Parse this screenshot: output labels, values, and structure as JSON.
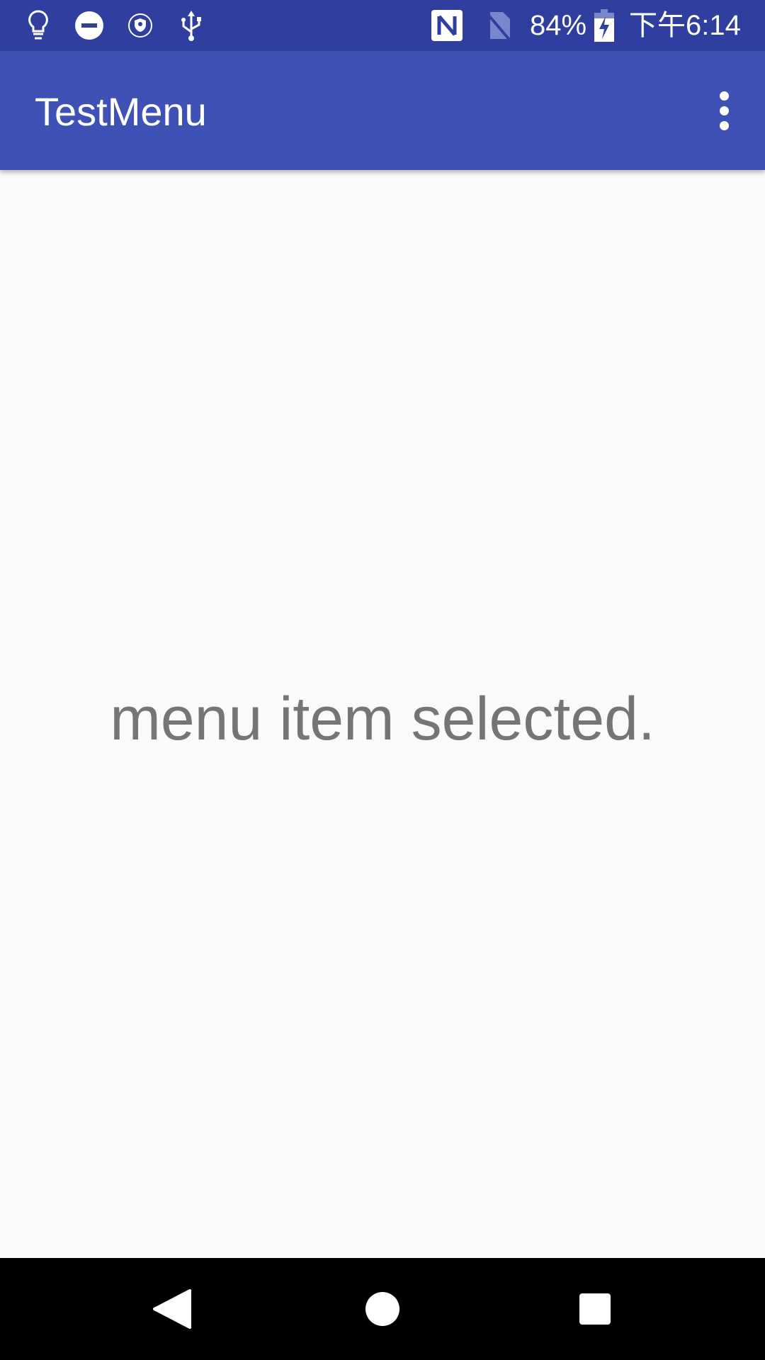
{
  "status_bar": {
    "icons": [
      "lightbulb-icon",
      "do-not-disturb-icon",
      "vpn-shield-icon",
      "usb-icon",
      "nfc-icon",
      "no-sim-icon",
      "battery-charging-icon"
    ],
    "battery": "84%",
    "time": "下午6:14"
  },
  "app_bar": {
    "title": "TestMenu",
    "overflow_icon": "more-vert-icon"
  },
  "main": {
    "message": "menu item selected."
  },
  "nav_bar": {
    "icons": [
      "back-icon",
      "home-icon",
      "recents-icon"
    ]
  },
  "colors": {
    "status_bar": "#303F9F",
    "app_bar": "#3F51B5",
    "background": "#FAFAFA",
    "message_text": "#757575"
  }
}
